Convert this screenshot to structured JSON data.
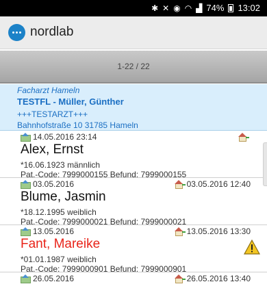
{
  "status_bar": {
    "signal_text": "74%",
    "time": "13:02",
    "icons": [
      "bluetooth-icon",
      "mute-icon",
      "alarm-icon",
      "wifi-icon",
      "signal-icon",
      "battery-icon"
    ]
  },
  "app": {
    "title": "nordlab",
    "logo_icon": "nordlab-logo-icon",
    "accent_color": "#1c82c8"
  },
  "pager": {
    "label": "1-22 / 22"
  },
  "doctor": {
    "specialty": "Facharzt Hameln",
    "name": "TESTFL - Müller, Günther",
    "tag": "+++TESTARZT+++",
    "address": "Bahnhofstraße 10 31785 Hameln",
    "text_color": "#1b6fc3"
  },
  "patients": [
    {
      "received": "14.05.2016 23:14",
      "home_date": "",
      "name": "Alex, Ernst",
      "details": "*16.06.1923 männlich",
      "codes": "Pat.-Code: 7999000155 Befund: 7999000155",
      "alert": false
    },
    {
      "received": "03.05.2016",
      "home_date": "03.05.2016 12:40",
      "name": "Blume, Jasmin",
      "details": "*18.12.1995 weiblich",
      "codes": "Pat.-Code: 7999000021 Befund: 7999000021",
      "alert": false
    },
    {
      "received": "13.05.2016",
      "home_date": "13.05.2016 13:30",
      "name": "Fant, Mareike",
      "details": "*01.01.1987 weiblich",
      "codes": "Pat.-Code: 7999000901 Befund: 7999000901",
      "alert": true,
      "alert_color": "#e8241a"
    },
    {
      "received": "26.05.2016",
      "home_date": "26.05.2016 13:40"
    }
  ]
}
